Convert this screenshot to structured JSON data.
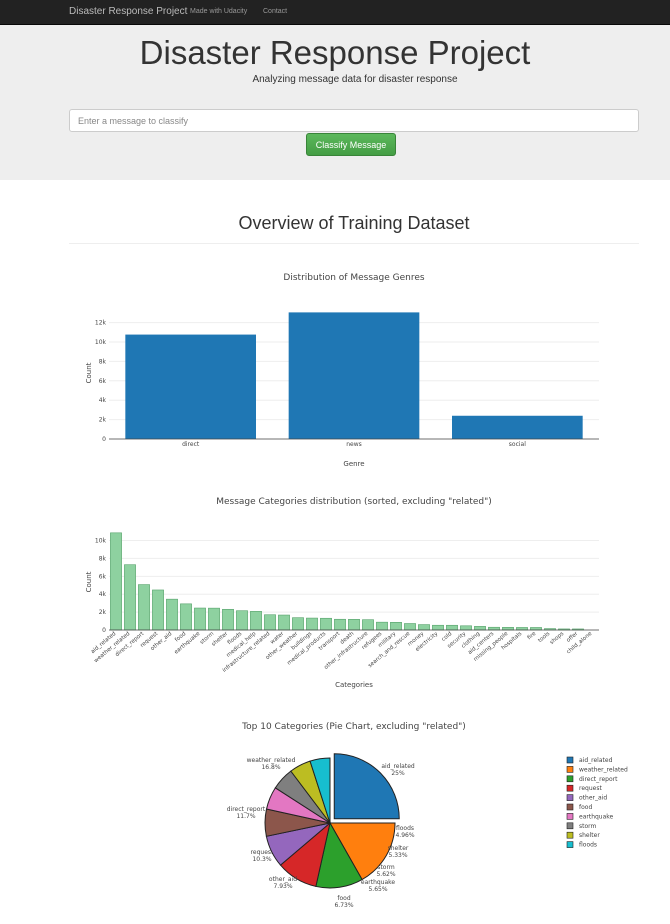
{
  "navbar": {
    "brand": "Disaster Response Project",
    "links": [
      "Made with Udacity",
      "Contact"
    ]
  },
  "hero": {
    "title": "Disaster Response Project",
    "subtitle": "Analyzing message data for disaster response",
    "input_placeholder": "Enter a message to classify",
    "button_label": "Classify Message"
  },
  "overview_title": "Overview of Training Dataset",
  "colors": {
    "genre_bar": "#1f77b4",
    "category_bar": "#8ed1a0",
    "category_bar_stroke": "#55a26a",
    "button_green": "#5cb85c",
    "navbar": "#222222",
    "jumbotron": "#eeeeee"
  },
  "chart_data": [
    {
      "type": "bar",
      "title": "Distribution of Message Genres",
      "xlabel": "Genre",
      "ylabel": "Count",
      "categories": [
        "direct",
        "news",
        "social"
      ],
      "values": [
        10766,
        13054,
        2396
      ],
      "ylim": [
        0,
        13300
      ],
      "yticks": [
        0,
        2000,
        4000,
        6000,
        8000,
        10000,
        12000
      ],
      "ytick_labels": [
        "0",
        "2k",
        "4k",
        "6k",
        "8k",
        "10k",
        "12k"
      ],
      "grid": true
    },
    {
      "type": "bar",
      "title": "Message Categories distribution (sorted, excluding \"related\")",
      "xlabel": "Categories",
      "ylabel": "Count",
      "categories": [
        "aid_related",
        "weather_related",
        "direct_report",
        "request",
        "other_aid",
        "food",
        "earthquake",
        "storm",
        "shelter",
        "floods",
        "medical_help",
        "infrastructure_related",
        "water",
        "other_weather",
        "buildings",
        "medical_products",
        "transport",
        "death",
        "other_infrastructure",
        "refugees",
        "military",
        "search_and_rescue",
        "money",
        "electricity",
        "cold",
        "security",
        "clothing",
        "aid_centers",
        "missing_people",
        "hospitals",
        "fire",
        "tools",
        "shops",
        "offer",
        "child_alone"
      ],
      "values": [
        10860,
        7297,
        5075,
        4474,
        3446,
        2923,
        2455,
        2443,
        2314,
        2155,
        2084,
        1705,
        1672,
        1376,
        1333,
        1313,
        1201,
        1194,
        1151,
        875,
        860,
        724,
        604,
        532,
        530,
        471,
        405,
        309,
        298,
        283,
        282,
        159,
        120,
        118,
        0
      ],
      "ylim": [
        0,
        11400
      ],
      "yticks": [
        0,
        2000,
        4000,
        6000,
        8000,
        10000
      ],
      "ytick_labels": [
        "0",
        "2k",
        "4k",
        "6k",
        "8k",
        "10k"
      ],
      "grid": true
    },
    {
      "type": "pie",
      "title": "Top 10 Categories (Pie Chart, excluding \"related\")",
      "labels": [
        "aid_related",
        "weather_related",
        "direct_report",
        "request",
        "other_aid",
        "food",
        "earthquake",
        "storm",
        "shelter",
        "floods"
      ],
      "values": [
        25,
        16.8,
        11.7,
        10.3,
        7.93,
        6.73,
        5.65,
        5.62,
        5.33,
        4.96
      ],
      "value_labels": [
        "25%",
        "16.8%",
        "11.7%",
        "10.3%",
        "7.93%",
        "6.73%",
        "5.65%",
        "5.62%",
        "5.33%",
        "4.96%"
      ],
      "colors": [
        "#1f77b4",
        "#ff7f0e",
        "#2ca02c",
        "#d62728",
        "#9467bd",
        "#8c564b",
        "#e377c2",
        "#7f7f7f",
        "#bcbd22",
        "#17becf"
      ],
      "pulled": [
        "aid_related"
      ],
      "legend_position": "right"
    }
  ]
}
